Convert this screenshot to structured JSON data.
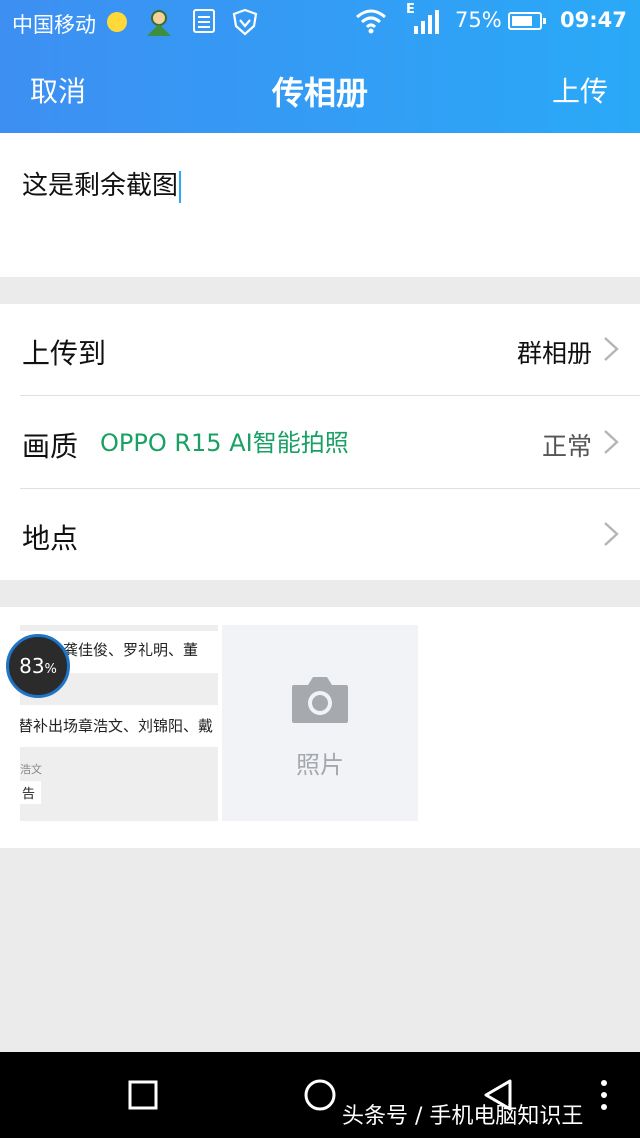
{
  "status_bar": {
    "carrier": "中国移动",
    "network_label": "E",
    "battery_percent": "75%",
    "battery_level": 0.75,
    "time": "09:47"
  },
  "header": {
    "cancel_label": "取消",
    "title": "传相册",
    "upload_label": "上传"
  },
  "caption": {
    "text": "这是剩余截图"
  },
  "settings": {
    "upload_to": {
      "label": "上传到",
      "value": "群相册"
    },
    "quality": {
      "label": "画质",
      "ad_text": "OPPO R15  AI智能拍照",
      "value": "正常"
    },
    "location": {
      "label": "地点"
    }
  },
  "photos": {
    "thumbnail": {
      "line1": "黄岩、龚佳俊、罗礼明、董",
      "line2": "替补出场章浩文、刘锦阳、戴",
      "small_text": "浩文",
      "tiny_text": "告"
    },
    "boost_percent": "83",
    "boost_unit": "%",
    "add_photo_label": "照片"
  },
  "watermark": "头条号 / 手机电脑知识王",
  "colors": {
    "header_gradient_start": "#3d8ff2",
    "header_gradient_end": "#2aa9f7",
    "ad_green": "#1aa065",
    "page_bg": "#ebebeb"
  }
}
